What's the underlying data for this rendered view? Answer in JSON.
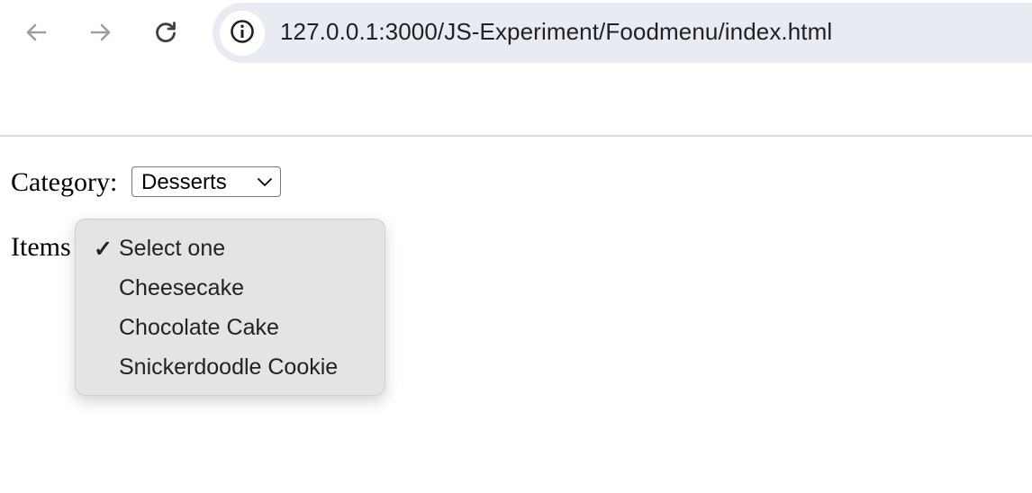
{
  "browser": {
    "url": "127.0.0.1:3000/JS-Experiment/Foodmenu/index.html",
    "icons": {
      "back": "arrow-left-icon",
      "forward": "arrow-right-icon",
      "reload": "reload-icon",
      "site_info": "info-icon"
    }
  },
  "form": {
    "category_label": "Category:",
    "category_selected": "Desserts",
    "items_label": "Items"
  },
  "dropdown": {
    "options": [
      {
        "label": "Select one",
        "checked": true
      },
      {
        "label": "Cheesecake",
        "checked": false
      },
      {
        "label": "Chocolate Cake",
        "checked": false
      },
      {
        "label": "Snickerdoodle Cookie",
        "checked": false
      }
    ],
    "check_mark": "✓"
  },
  "colors": {
    "omnibox_bg": "#e8ebf2",
    "dropdown_bg": "#e4e4e6"
  }
}
